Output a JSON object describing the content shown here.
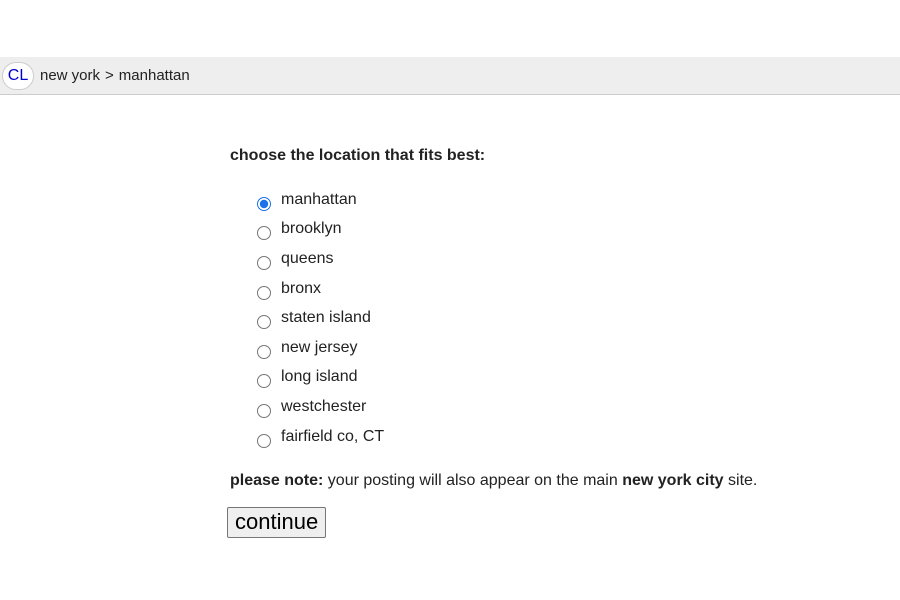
{
  "header": {
    "logo_text": "CL",
    "breadcrumb": [
      "new york",
      "manhattan"
    ],
    "separator": ">"
  },
  "form": {
    "prompt": "choose the location that fits best:",
    "selected": "manhattan",
    "options": [
      "manhattan",
      "brooklyn",
      "queens",
      "bronx",
      "staten island",
      "new jersey",
      "long island",
      "westchester",
      "fairfield co, CT"
    ],
    "note": {
      "lead": "please note:",
      "text_before": " your posting will also appear on the main ",
      "emphasis": "new york city",
      "text_after": " site."
    },
    "continue_label": "continue"
  },
  "colors": {
    "header_bg": "#eeeeee",
    "logo_text": "#0000cc",
    "radio_accent": "#1a73e8"
  }
}
